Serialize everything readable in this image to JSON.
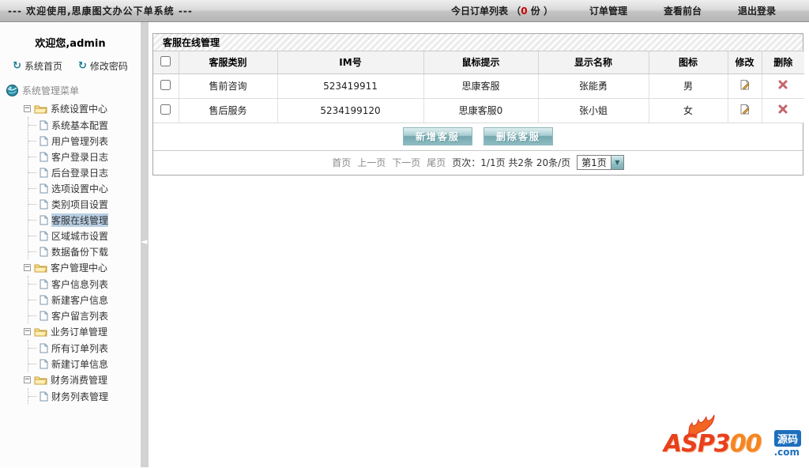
{
  "topbar": {
    "title": "--- 欢迎使用,思康图文办公下单系统 ---",
    "today_label": "今日订单列表 （",
    "today_count": "0",
    "today_suffix": " 份 ）",
    "nav": [
      {
        "label": "订单管理"
      },
      {
        "label": "查看前台"
      },
      {
        "label": "退出登录"
      }
    ]
  },
  "sidebar": {
    "welcome": "欢迎您,admin",
    "links": [
      {
        "label": "系统首页"
      },
      {
        "label": "修改密码"
      }
    ],
    "menu_title": "系统管理菜单",
    "tree": [
      {
        "label": "系统设置中心",
        "children": [
          "系统基本配置",
          "用户管理列表",
          "客户登录日志",
          "后台登录日志",
          "选项设置中心",
          "类别项目设置",
          "客服在线管理",
          "区域城市设置",
          "数据备份下载"
        ]
      },
      {
        "label": "客户管理中心",
        "children": [
          "客户信息列表",
          "新建客户信息",
          "客户留言列表"
        ]
      },
      {
        "label": "业务订单管理",
        "children": [
          "所有订单列表",
          "新建订单信息"
        ]
      },
      {
        "label": "财务消费管理",
        "children": [
          "财务列表管理"
        ]
      }
    ],
    "active_item": "客服在线管理",
    "collapse_arrow": "◄"
  },
  "panel": {
    "title": "客服在线管理",
    "table": {
      "headers": [
        "客服类别",
        "IM号",
        "鼠标提示",
        "显示名称",
        "图标",
        "修改",
        "删除"
      ],
      "rows": [
        {
          "category": "售前咨询",
          "im": "523419911",
          "tooltip": "思康客服",
          "display_name": "张能勇",
          "icon_text": "男"
        },
        {
          "category": "售后服务",
          "im": "5234199120",
          "tooltip": "思康客服0",
          "display_name": "张小姐",
          "icon_text": "女"
        }
      ]
    },
    "buttons": {
      "add": "新增客服",
      "remove": "删除客服"
    },
    "pagination": {
      "first": "首页",
      "prev": "上一页",
      "next": "下一页",
      "last": "尾页",
      "info": "页次：1/1页 共2条 20条/页",
      "page_select": "第1页",
      "dropdown_glyph": "▼"
    }
  },
  "logo": {
    "brand_left": "ASP3",
    "brand_right": "00",
    "tag": "源码",
    "com": ".com"
  },
  "colors": {
    "accent_teal": "#79aeb4",
    "active_item_bg": "#b9cfe4",
    "count_red": "#cc0000",
    "delete_red": "#c4656b"
  }
}
